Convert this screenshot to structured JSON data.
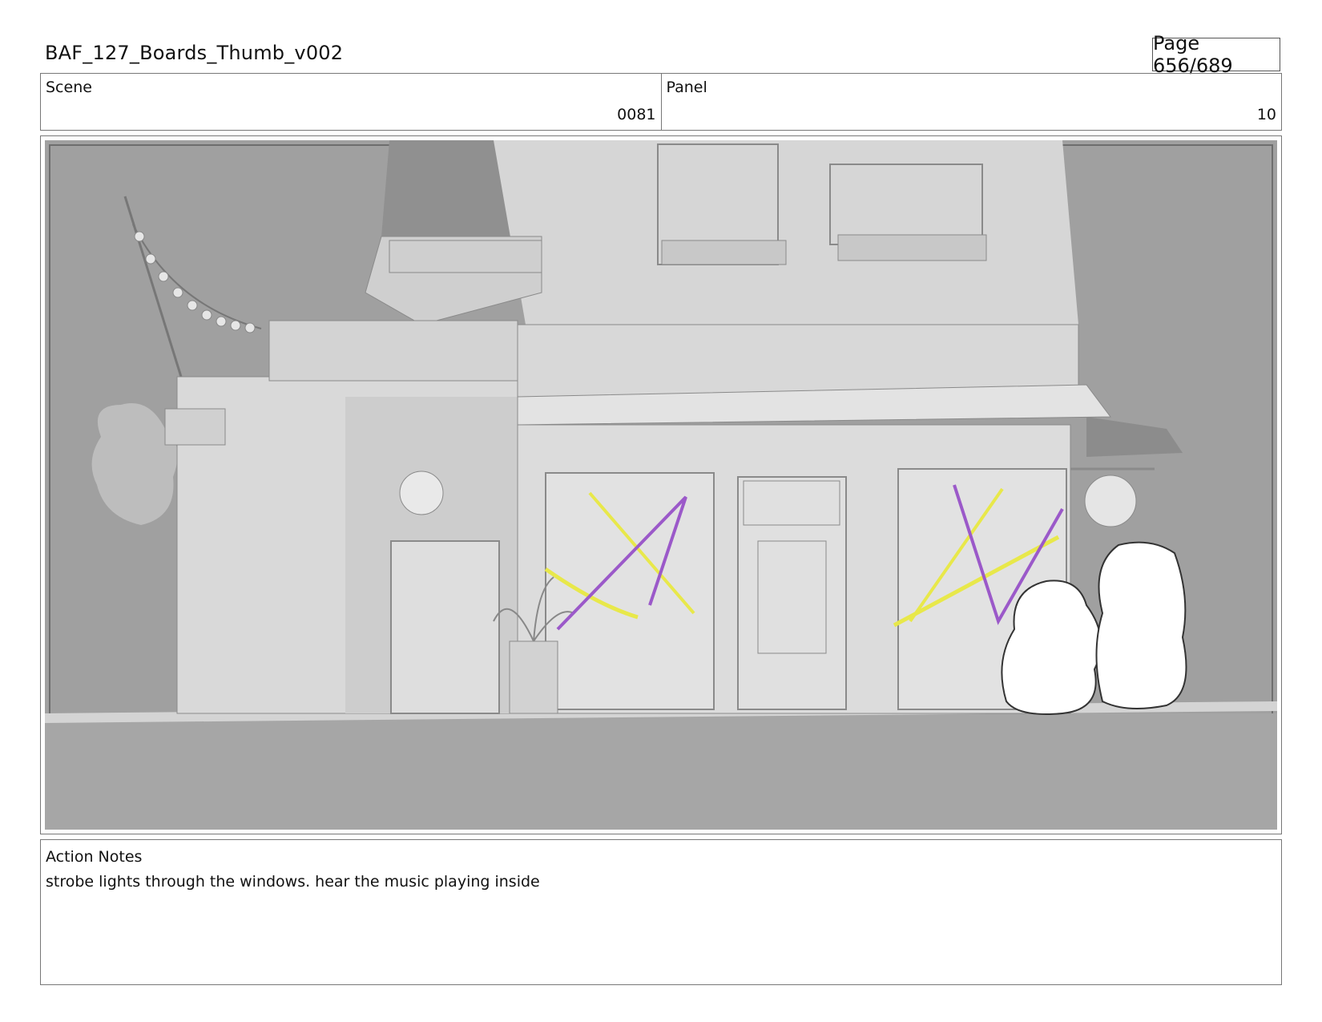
{
  "header": {
    "title": "BAF_127_Boards_Thumb_v002",
    "page": "Page 656/689"
  },
  "info": {
    "scene_label": "Scene",
    "scene_value": "0081",
    "panel_label": "Panel",
    "panel_value": "10"
  },
  "notes": {
    "label": "Action Notes",
    "text": "strobe lights through the windows. hear the music playing inside"
  },
  "colors": {
    "strobe_purple": "#9b59c9",
    "strobe_yellow": "#e8e84a",
    "background_gray": "#9b9b9b",
    "building_gray": "#dcdcdc"
  }
}
